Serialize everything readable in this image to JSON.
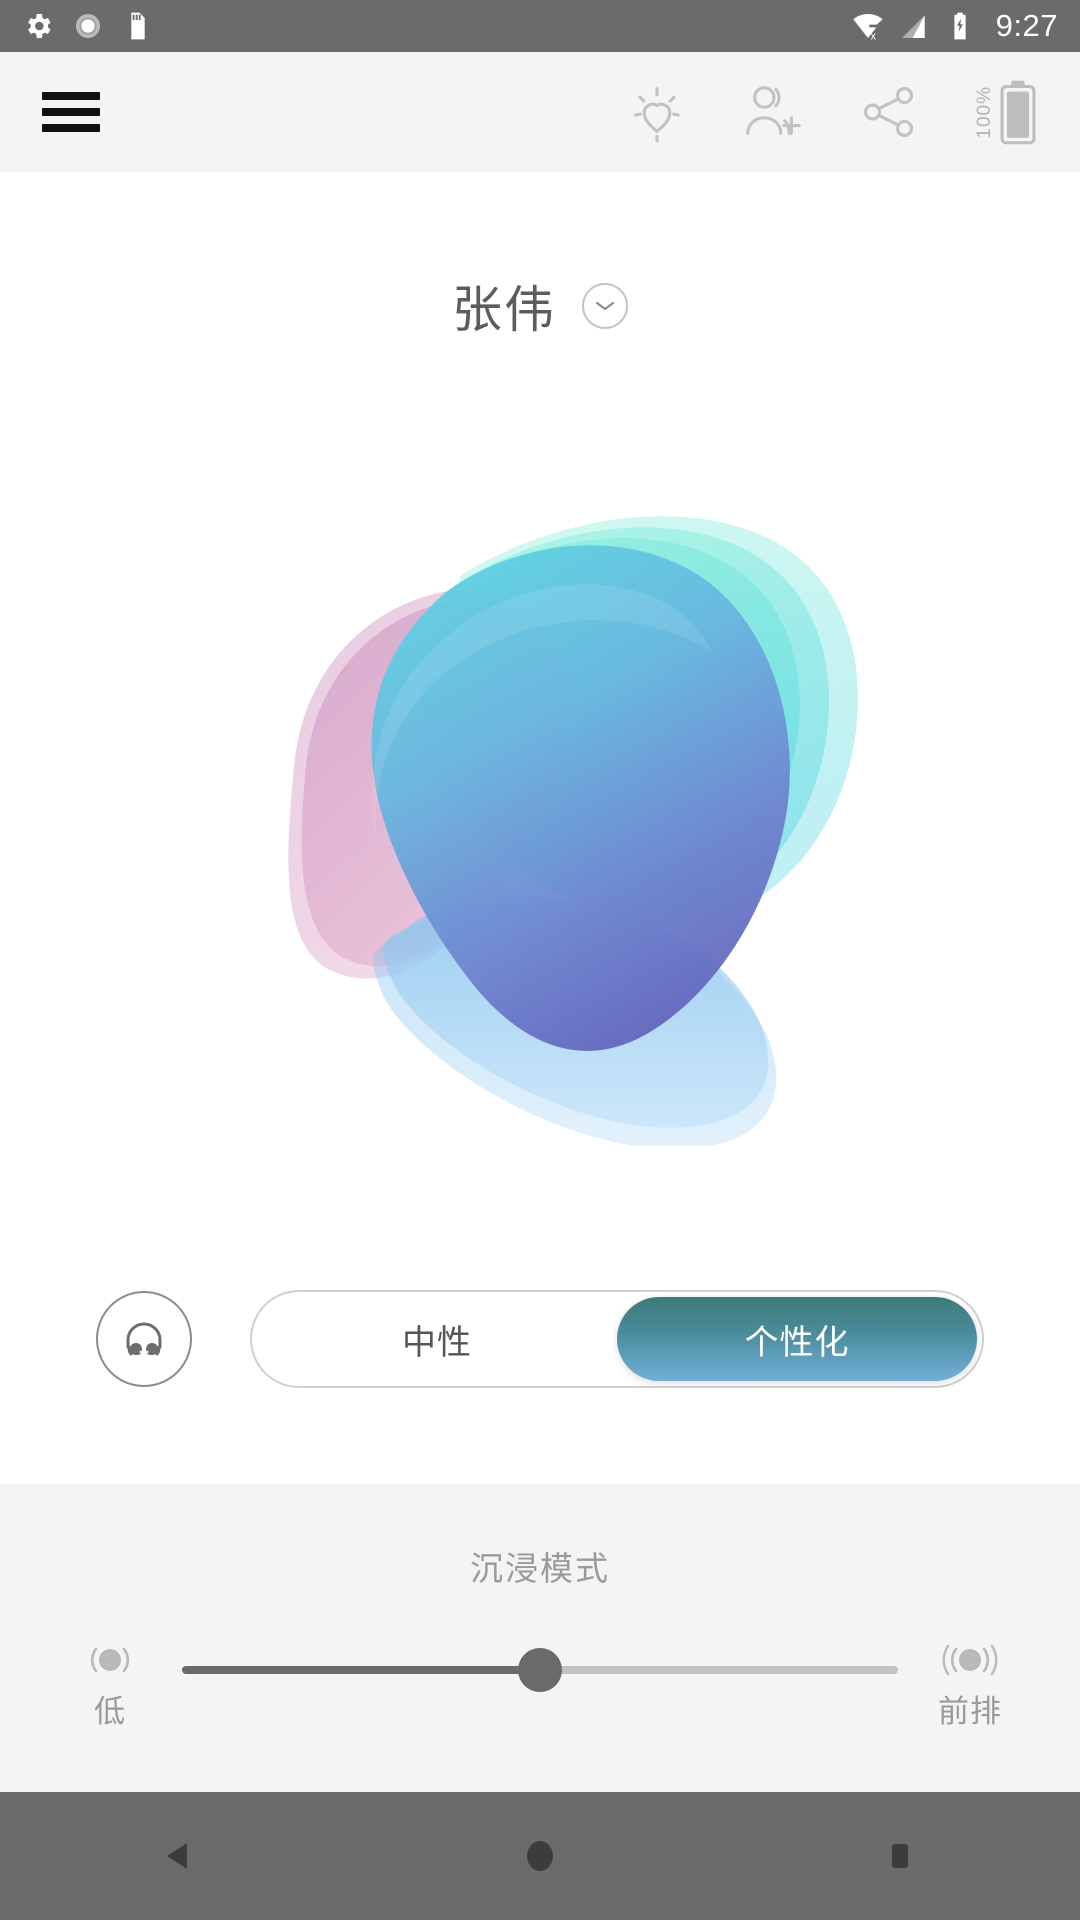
{
  "status_bar": {
    "time": "9:27",
    "left_icons": [
      "settings-gear-icon",
      "sync-spinner-icon",
      "sd-card-icon"
    ],
    "right_icons": [
      "wifi-off-icon",
      "cellular-signal-icon",
      "battery-charging-icon"
    ]
  },
  "app_bar": {
    "menu_icon": "hamburger-menu-icon",
    "actions": [
      {
        "name": "wellbeing-heart-icon",
        "label": ""
      },
      {
        "name": "add-person-icon",
        "label": ""
      },
      {
        "name": "share-icon",
        "label": ""
      }
    ],
    "battery": {
      "percent_label": "100%",
      "icon": "battery-full-icon"
    }
  },
  "profile": {
    "name": "张伟",
    "chevron_icon": "chevron-down-icon"
  },
  "artwork": {
    "name": "sound-profile-blob",
    "colors": {
      "teal": "#7fe8d2",
      "cyan": "#5cd3e0",
      "blue": "#6d8fd8",
      "indigo": "#6a6fc0",
      "magenta": "#c98fba",
      "pink": "#e0aac8",
      "light_blue": "#a9d4f5"
    }
  },
  "mode": {
    "headphone_icon": "headphones-icon",
    "options": [
      {
        "label": "中性",
        "active": false
      },
      {
        "label": "个性化",
        "active": true
      }
    ],
    "active_gradient_from": "#3d7b7a",
    "active_gradient_to": "#72b0d8"
  },
  "immersive": {
    "title": "沉浸模式",
    "left": {
      "label": "低",
      "icon": "sound-low-icon"
    },
    "right": {
      "label": "前排",
      "icon": "sound-front-row-icon"
    },
    "value_percent": 50
  },
  "nav_bar": {
    "buttons": [
      {
        "name": "nav-back-button",
        "icon": "triangle-back-icon"
      },
      {
        "name": "nav-home-button",
        "icon": "circle-home-icon"
      },
      {
        "name": "nav-recents-button",
        "icon": "square-recents-icon"
      }
    ]
  }
}
